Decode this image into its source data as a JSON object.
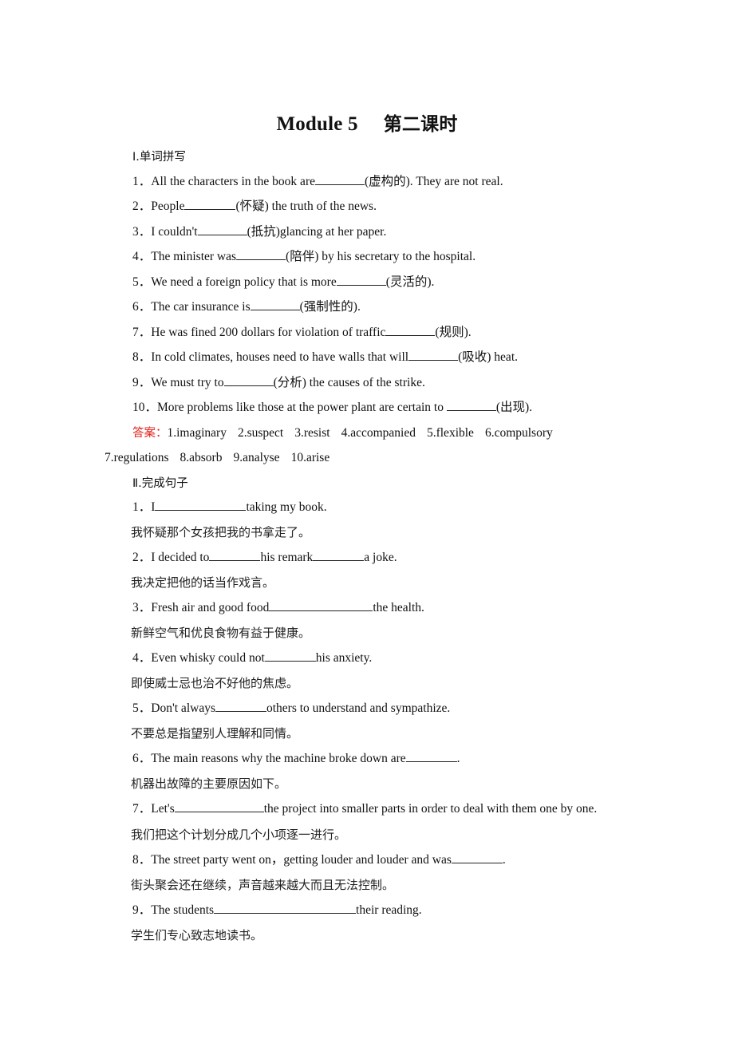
{
  "title": {
    "en": "Module 5",
    "cn": "第二课时"
  },
  "section1": {
    "heading": "Ⅰ.单词拼写",
    "items": [
      {
        "num": "1．",
        "before": "All the characters in the book are",
        "after": "(虚构的). They are not real."
      },
      {
        "num": "2．",
        "before": "People",
        "after": "(怀疑) the truth of the news."
      },
      {
        "num": "3．",
        "before": "I couldn't",
        "after": "(抵抗)glancing at her paper."
      },
      {
        "num": "4．",
        "before": "The minister was",
        "after": "(陪伴) by his secretary to the hospital."
      },
      {
        "num": "5．",
        "before": "We need a foreign policy that is more",
        "after": "(灵活的)."
      },
      {
        "num": "6．",
        "before": "The car insurance is",
        "after": "(强制性的)."
      },
      {
        "num": "7．",
        "before": "He was fined 200 dollars for violation of traffic",
        "after": "(规则)."
      },
      {
        "num": "8．",
        "before": "In cold climates, houses need to have walls that will",
        "after": "(吸收) heat."
      },
      {
        "num": "9．",
        "before": "We must try to",
        "after": "(分析) the causes of the strike."
      },
      {
        "num": "10．",
        "before": "More problems like those at the power plant are certain to ",
        "after": "(出现)."
      }
    ],
    "answer_label": "答案：",
    "answers_line1": [
      "1.imaginary",
      "2.suspect",
      "3.resist",
      "4.accompanied",
      "5.flexible",
      "6.compulsory"
    ],
    "answers_line2": [
      "7.regulations",
      "8.absorb",
      "9.analyse",
      "10.arise"
    ]
  },
  "section2": {
    "heading": "Ⅱ.完成句子",
    "items": [
      {
        "num": "1．",
        "parts": [
          "I",
          "taking my book."
        ],
        "cn": "我怀疑那个女孩把我的书拿走了。"
      },
      {
        "num": "2．",
        "parts": [
          "I decided to",
          "his remark",
          "a joke."
        ],
        "cn": "我决定把他的话当作戏言。"
      },
      {
        "num": "3．",
        "parts": [
          "Fresh air and good food",
          "the health."
        ],
        "cn": "新鲜空气和优良食物有益于健康。"
      },
      {
        "num": "4．",
        "parts": [
          "Even whisky could not",
          "his anxiety."
        ],
        "cn": "即使威士忌也治不好他的焦虑。"
      },
      {
        "num": "5．",
        "parts": [
          "Don't always",
          "others to understand and sympathize."
        ],
        "cn": "不要总是指望别人理解和同情。"
      },
      {
        "num": "6．",
        "parts": [
          "The main reasons why the machine broke down are",
          "."
        ],
        "cn": "机器出故障的主要原因如下。"
      },
      {
        "num": "7．",
        "parts": [
          "Let's",
          "the project into smaller parts in order to deal with them one by one."
        ],
        "cn": "我们把这个计划分成几个小项逐一进行。"
      },
      {
        "num": "8．",
        "parts": [
          "The street party went on，getting louder and louder and was",
          "."
        ],
        "cn": "街头聚会还在继续，声音越来越大而且无法控制。"
      },
      {
        "num": "9．",
        "parts": [
          "The students",
          "their reading."
        ],
        "cn": "学生们专心致志地读书。"
      }
    ]
  },
  "colors": {
    "answer_label": "#e0201a",
    "text": "#111111"
  }
}
